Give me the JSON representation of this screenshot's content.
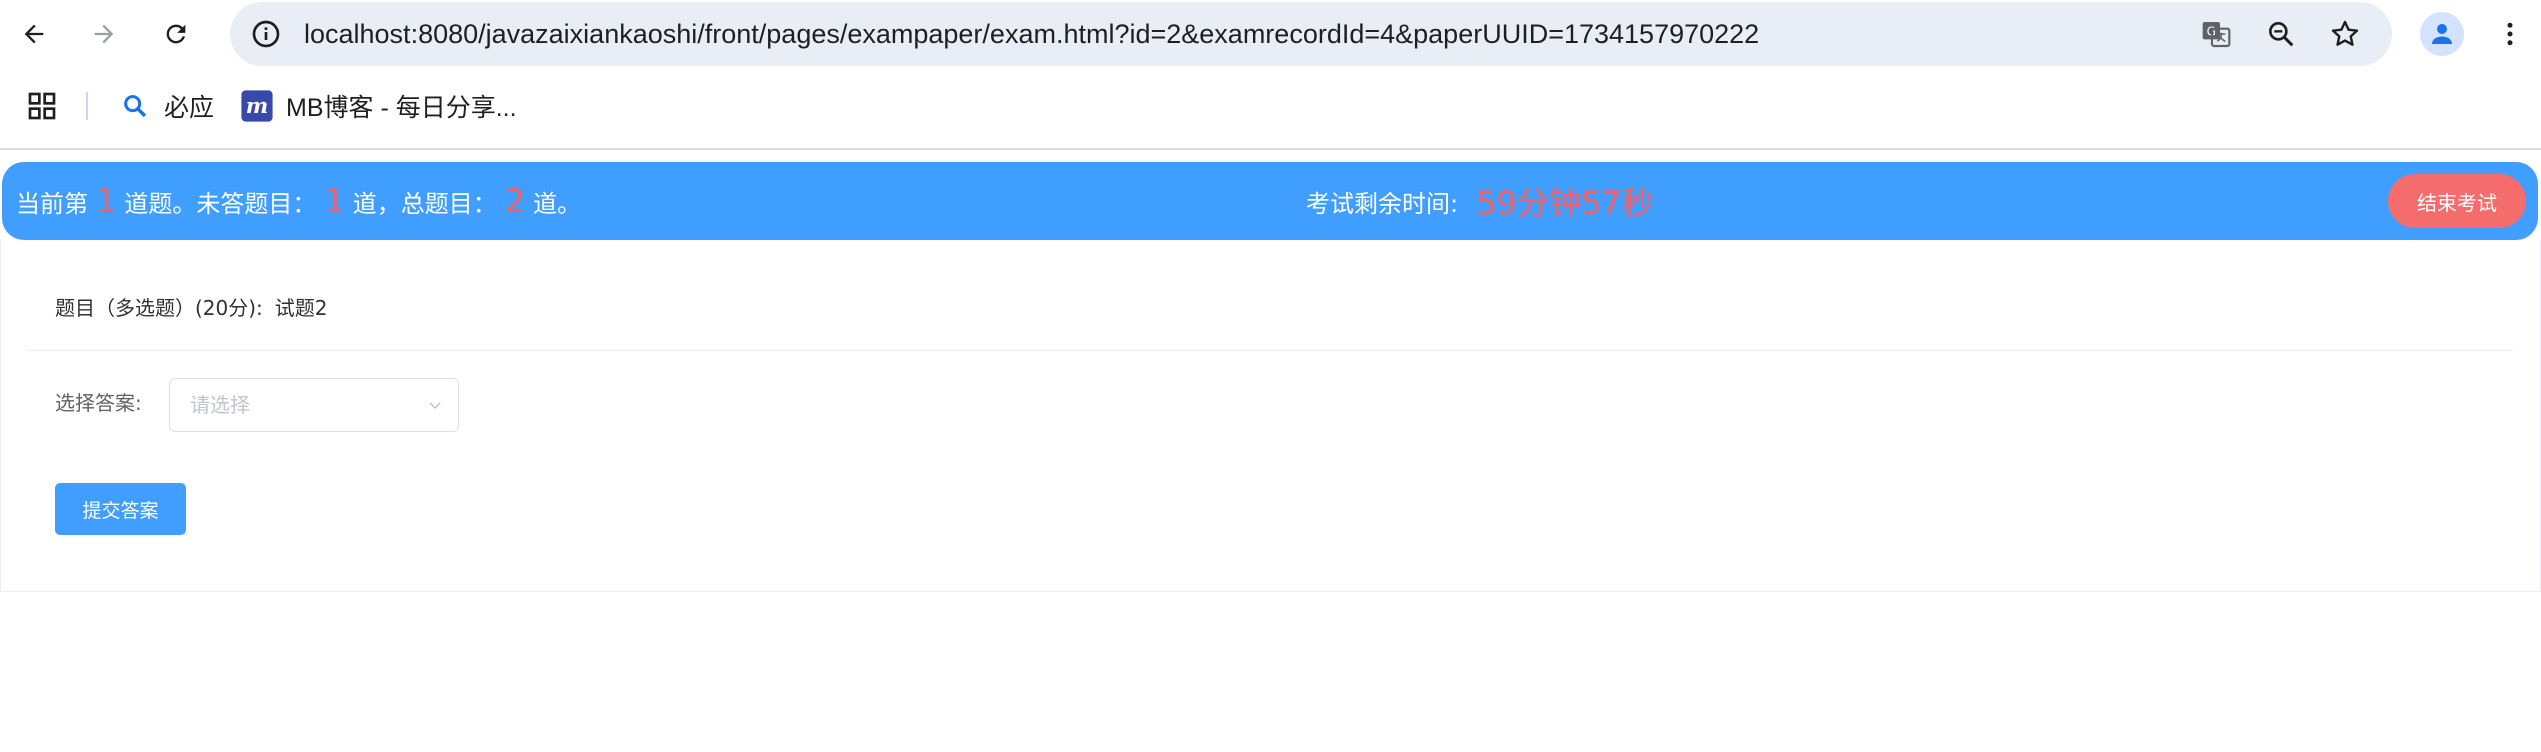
{
  "browser": {
    "url": "localhost:8080/javazaixiankaoshi/front/pages/exampaper/exam.html?id=2&examrecordId=4&paperUUID=1734157970222",
    "bookmarks": [
      {
        "label": "必应",
        "icon": "search-icon"
      },
      {
        "label": "MB博客 - 每日分享...",
        "icon": "mb-logo-icon"
      }
    ],
    "colors": {
      "omnibox_bg": "#e9eef6",
      "profile_blue": "#1a73e8"
    }
  },
  "exam": {
    "status": {
      "current_prefix": "当前第",
      "current_num": "1",
      "current_suffix": "道题。未答题目：",
      "unanswered_num": "1",
      "unanswered_suffix": "道，总题目：",
      "total_num": "2",
      "total_suffix": "道。"
    },
    "timer_label": "考试剩余时间:",
    "timer_value": "59分钟57秒",
    "end_button": "结束考试",
    "question_label": "题目（多选题）(20分):",
    "question_text": "试题2",
    "answer_label": "选择答案:",
    "answer_placeholder": "请选择",
    "submit_button": "提交答案",
    "colors": {
      "header_bg": "#409eff",
      "highlight": "#ff5c5c",
      "end_button_bg": "#f56c6c",
      "primary": "#409eff"
    }
  }
}
